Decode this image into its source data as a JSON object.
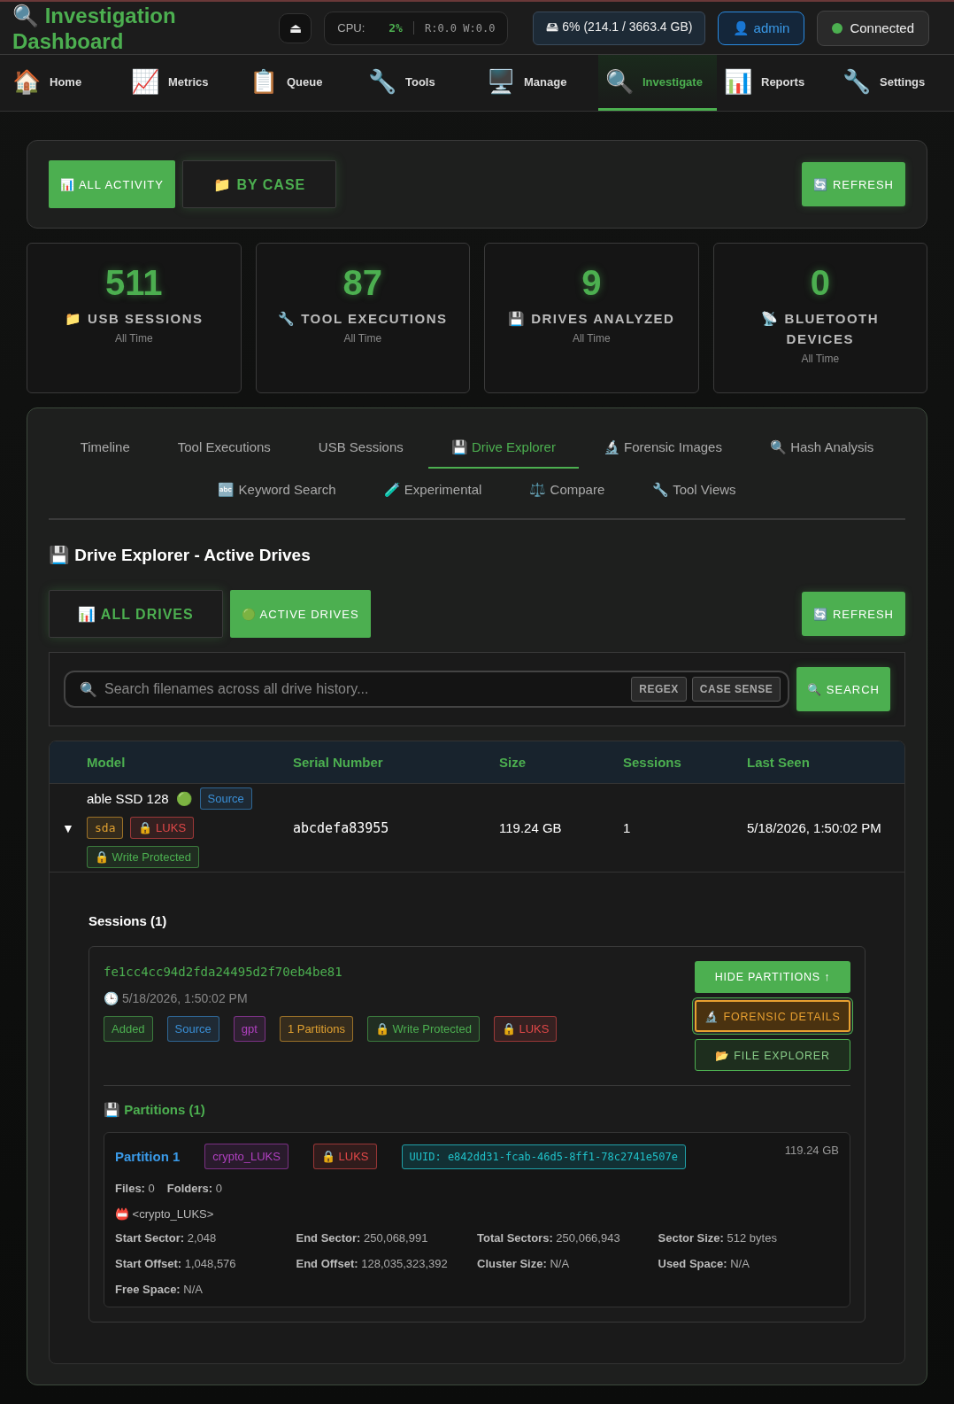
{
  "header": {
    "title": "🔍 Investigation Dashboard",
    "eject": "⏏",
    "cpu": {
      "label": "CPU:",
      "value": "2%",
      "io": "R:0.0 W:0.0"
    },
    "disk": "🖴 6% (214.1 / 3663.4 GB)",
    "user": "👤 admin",
    "connection": {
      "label": "Connected",
      "color": "#4caf50"
    }
  },
  "nav": [
    {
      "icon": "🏠",
      "label": "Home",
      "selected": false
    },
    {
      "icon": "📈",
      "label": "Metrics",
      "selected": false
    },
    {
      "icon": "📋",
      "label": "Queue",
      "selected": false
    },
    {
      "icon": "🔧",
      "label": "Tools",
      "selected": false
    },
    {
      "icon": "🖥️",
      "label": "Manage",
      "selected": false
    },
    {
      "icon": "🔍",
      "label": "Investigate",
      "selected": true
    },
    {
      "icon": "📊",
      "label": "Reports",
      "selected": false
    },
    {
      "icon": "🔧",
      "label": "Settings",
      "selected": false
    }
  ],
  "view_toggle": [
    {
      "label": "📊 ALL ACTIVITY",
      "selected": true
    },
    {
      "label": "📁 BY CASE",
      "selected": false
    }
  ],
  "refresh": "🔄 REFRESH",
  "stats": [
    {
      "value": "511",
      "label": "📁 USB SESSIONS",
      "sub": "All Time"
    },
    {
      "value": "87",
      "label": "🔧 TOOL EXECUTIONS",
      "sub": "All Time"
    },
    {
      "value": "9",
      "label": "💾 DRIVES ANALYZED",
      "sub": "All Time"
    },
    {
      "value": "0",
      "label": "📡 BLUETOOTH DEVICES",
      "sub": "All Time"
    }
  ],
  "tab_rows": [
    [
      {
        "label": "Timeline",
        "selected": false
      },
      {
        "label": "Tool Executions",
        "selected": false
      },
      {
        "label": "USB Sessions",
        "selected": false
      },
      {
        "label": "💾 Drive Explorer",
        "selected": true
      },
      {
        "label": "🔬 Forensic Images",
        "selected": false
      },
      {
        "label": "🔍 Hash Analysis",
        "selected": false
      }
    ],
    [
      {
        "label": "🔤 Keyword Search",
        "selected": false
      },
      {
        "label": "🧪 Experimental",
        "selected": false
      },
      {
        "label": "⚖️ Compare",
        "selected": false
      },
      {
        "label": "🔧 Tool Views",
        "selected": false
      }
    ]
  ],
  "explorer": {
    "title": "💾 Drive Explorer - Active Drives",
    "filter": [
      {
        "label": "📊 ALL DRIVES",
        "selected": false
      },
      {
        "label": "🟢 ACTIVE DRIVES",
        "selected": true
      }
    ],
    "refresh": "🔄 REFRESH",
    "search": {
      "icon": "🔍",
      "placeholder": "Search filenames across all drive history...",
      "options": [
        {
          "label": "REGEX",
          "on": false
        },
        {
          "label": "CASE SENSE",
          "on": false
        }
      ],
      "button": "🔍 SEARCH"
    },
    "table": {
      "columns": [
        "Model",
        "Serial Number",
        "Size",
        "Sessions",
        "Last Seen"
      ],
      "rows": [
        {
          "toggle": "▼",
          "expanded": true,
          "model": "able SSD 128",
          "status_icon": "🟢",
          "tags": [
            {
              "label": "Source",
              "color": "#3a8fd6"
            },
            {
              "label": "sda",
              "color": "#e0a030",
              "mono": true
            },
            {
              "label": "🔒 LUKS",
              "color": "#e04848"
            },
            {
              "label": "🔒 Write Protected",
              "color": "#4caf50"
            }
          ],
          "serial": "abcdefa83955",
          "size": "119.24 GB",
          "sessions": "1",
          "last_seen": "5/18/2026, 1:50:02 PM",
          "detail": {
            "title": "Sessions (1)",
            "sessions": [
              {
                "id": "fe1cc4cc94d2fda24495d2f70eb4be81",
                "time": "🕒 5/18/2026, 1:50:02 PM",
                "tags": [
                  {
                    "label": "Added",
                    "color": "#4caf50"
                  },
                  {
                    "label": "Source",
                    "color": "#3a8fd6"
                  },
                  {
                    "label": "gpt",
                    "color": "#b040c0"
                  },
                  {
                    "label": "1 Partitions",
                    "color": "#e0a030"
                  },
                  {
                    "label": "🔒 Write Protected",
                    "color": "#4caf50"
                  },
                  {
                    "label": "🔒 LUKS",
                    "color": "#e04848"
                  }
                ],
                "actions": [
                  {
                    "label": "HIDE PARTITIONS ↑",
                    "kind": "primary"
                  },
                  {
                    "label": "🔬 FORENSIC DETAILS",
                    "kind": "warning"
                  },
                  {
                    "label": "📂 FILE EXPLORER",
                    "kind": "outline"
                  }
                ],
                "partitions_title": "💾 Partitions (1)",
                "partitions": [
                  {
                    "name": "Partition 1",
                    "tags": [
                      {
                        "label": "crypto_LUKS",
                        "color": "#b040c0"
                      },
                      {
                        "label": "🔒 LUKS",
                        "color": "#e04848"
                      }
                    ],
                    "uuid": "UUID: e842dd31-fcab-46d5-8ff1-78c2741e507e",
                    "size": "119.24 GB",
                    "counts": [
                      {
                        "label": "Files:",
                        "value": "0"
                      },
                      {
                        "label": "Folders:",
                        "value": "0"
                      }
                    ],
                    "filesystem": "📛 <crypto_LUKS>",
                    "props": [
                      {
                        "label": "Start Sector:",
                        "value": "2,048"
                      },
                      {
                        "label": "End Sector:",
                        "value": "250,068,991"
                      },
                      {
                        "label": "Total Sectors:",
                        "value": "250,066,943"
                      },
                      {
                        "label": "Sector Size:",
                        "value": "512 bytes"
                      },
                      {
                        "label": "Start Offset:",
                        "value": "1,048,576"
                      },
                      {
                        "label": "End Offset:",
                        "value": "128,035,323,392"
                      },
                      {
                        "label": "Cluster Size:",
                        "value": "N/A"
                      },
                      {
                        "label": "Used Space:",
                        "value": "N/A"
                      },
                      {
                        "label": "Free Space:",
                        "value": "N/A"
                      }
                    ]
                  }
                ]
              }
            ]
          }
        }
      ]
    }
  }
}
